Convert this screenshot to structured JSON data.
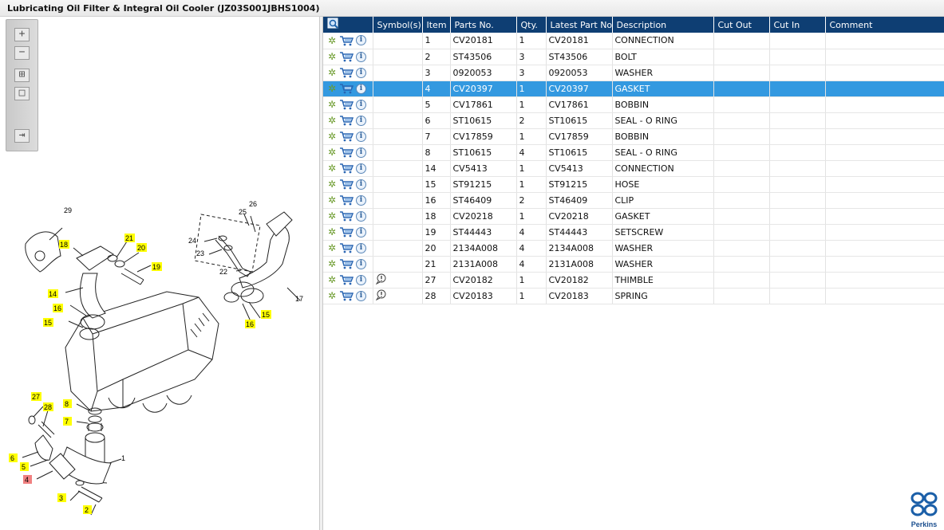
{
  "window": {
    "title": "Lubricating Oil Filter & Integral Oil Cooler (JZ03S001JBHS1004)"
  },
  "toolbar": {
    "zoom_in": "+",
    "zoom_out": "−",
    "fit": "⊞",
    "reset": "□",
    "export": "⇥"
  },
  "diagram": {
    "callouts": [
      "29",
      "18",
      "21",
      "20",
      "19",
      "14",
      "16",
      "15",
      "25",
      "26",
      "24",
      "23",
      "22",
      "17",
      "16",
      "15",
      "27",
      "28",
      "8",
      "7",
      "6",
      "5",
      "4",
      "3",
      "2",
      "1"
    ]
  },
  "grid": {
    "columns": [
      "Symbol(s)",
      "Item",
      "Parts No.",
      "Qty.",
      "Latest Part No.",
      "Description",
      "Cut Out",
      "Cut In",
      "Comment"
    ],
    "rows": [
      {
        "item": "1",
        "part": "CV20181",
        "qty": "1",
        "latest": "CV20181",
        "desc": "CONNECTION",
        "symbol": ""
      },
      {
        "item": "2",
        "part": "ST43506",
        "qty": "3",
        "latest": "ST43506",
        "desc": "BOLT",
        "symbol": ""
      },
      {
        "item": "3",
        "part": "0920053",
        "qty": "3",
        "latest": "0920053",
        "desc": "WASHER",
        "symbol": ""
      },
      {
        "item": "4",
        "part": "CV20397",
        "qty": "1",
        "latest": "CV20397",
        "desc": "GASKET",
        "symbol": ""
      },
      {
        "item": "5",
        "part": "CV17861",
        "qty": "1",
        "latest": "CV17861",
        "desc": "BOBBIN",
        "symbol": ""
      },
      {
        "item": "6",
        "part": "ST10615",
        "qty": "2",
        "latest": "ST10615",
        "desc": "SEAL - O RING",
        "symbol": ""
      },
      {
        "item": "7",
        "part": "CV17859",
        "qty": "1",
        "latest": "CV17859",
        "desc": "BOBBIN",
        "symbol": ""
      },
      {
        "item": "8",
        "part": "ST10615",
        "qty": "4",
        "latest": "ST10615",
        "desc": "SEAL - O RING",
        "symbol": ""
      },
      {
        "item": "14",
        "part": "CV5413",
        "qty": "1",
        "latest": "CV5413",
        "desc": "CONNECTION",
        "symbol": ""
      },
      {
        "item": "15",
        "part": "ST91215",
        "qty": "1",
        "latest": "ST91215",
        "desc": "HOSE",
        "symbol": ""
      },
      {
        "item": "16",
        "part": "ST46409",
        "qty": "2",
        "latest": "ST46409",
        "desc": "CLIP",
        "symbol": ""
      },
      {
        "item": "18",
        "part": "CV20218",
        "qty": "1",
        "latest": "CV20218",
        "desc": "GASKET",
        "symbol": ""
      },
      {
        "item": "19",
        "part": "ST44443",
        "qty": "4",
        "latest": "ST44443",
        "desc": "SETSCREW",
        "symbol": ""
      },
      {
        "item": "20",
        "part": "2134A008",
        "qty": "4",
        "latest": "2134A008",
        "desc": "WASHER",
        "symbol": ""
      },
      {
        "item": "21",
        "part": "2131A008",
        "qty": "4",
        "latest": "2131A008",
        "desc": "WASHER",
        "symbol": ""
      },
      {
        "item": "27",
        "part": "CV20182",
        "qty": "1",
        "latest": "CV20182",
        "desc": "THIMBLE",
        "symbol": "note"
      },
      {
        "item": "28",
        "part": "CV20183",
        "qty": "1",
        "latest": "CV20183",
        "desc": "SPRING",
        "symbol": "note"
      }
    ],
    "selected_item": "4"
  },
  "colors": {
    "header": "#0e3e73",
    "selected": "#3399e0",
    "callout_yellow": "#ffff00",
    "callout_red": "#f08080"
  },
  "brand": {
    "name": "Perkins"
  }
}
